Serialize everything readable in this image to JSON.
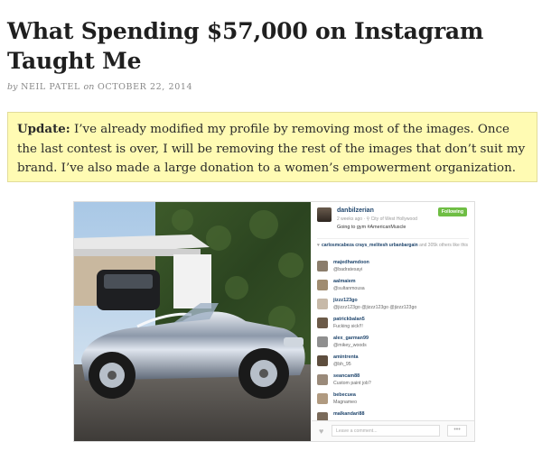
{
  "article": {
    "title": "What Spending $57,000 on Instagram Taught Me",
    "by_prefix": "by",
    "author": "NEIL PATEL",
    "on_word": "on",
    "date": "OCTOBER 22, 2014"
  },
  "update": {
    "label": "Update:",
    "text": " I’ve already modified my profile by removing most of the images. Once the last contest is over, I will be removing the rest of the images that don’t suit my brand. I’ve also made a large donation to a women’s empowerment organization."
  },
  "instagram": {
    "username": "danbilzerian",
    "meta": "2 weeks ago · ⚲ City of West Hollywood",
    "caption": "Going to gym #AmericanMuscle",
    "follow_label": "Following",
    "likes_names": "carlosmcabeza  crays_melitesh  urbanbargain",
    "likes_rest": " and 305k others like this",
    "comments": [
      {
        "user": "majedhamdoon",
        "text": "@badratesayi"
      },
      {
        "user": "aalmaiem",
        "text": "@sultanmousa"
      },
      {
        "user": "jizzz123go",
        "text": "@jizzz123go @jizzz123go @jizzz123go"
      },
      {
        "user": "patrickbalan5",
        "text": "Fucking sick!!!"
      },
      {
        "user": "alex_garman99",
        "text": "@mikey_woods"
      },
      {
        "user": "amintrenta",
        "text": "@bh_95"
      },
      {
        "user": "seancam88",
        "text": "Custom paint job?"
      },
      {
        "user": "bebecuea",
        "text": "Magnameo"
      },
      {
        "user": "malkandari88",
        "text": ""
      }
    ],
    "comment_placeholder": "Leave a comment...",
    "more_label": "•••"
  },
  "colors": {
    "update_bg": "#fffbb3",
    "follow_green": "#6fbe44",
    "link_blue": "#20466d"
  }
}
